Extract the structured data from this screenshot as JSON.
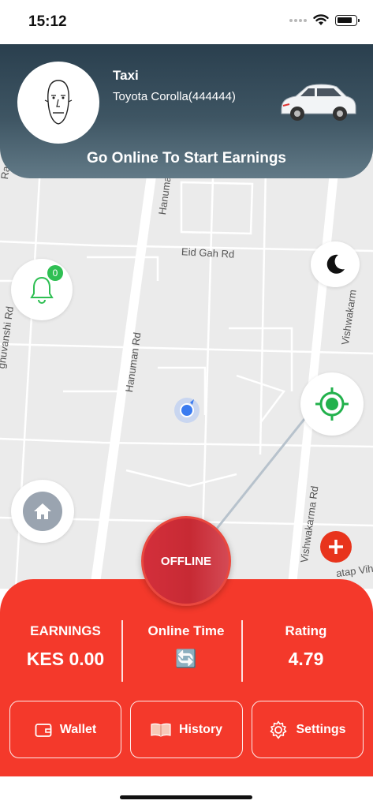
{
  "status_bar": {
    "time": "15:12"
  },
  "header": {
    "driver_type": "Taxi",
    "vehicle": "Toyota Corolla(444444)",
    "online_message": "Go Online To Start Earnings"
  },
  "map": {
    "roads": [
      "Raghuvansh",
      "Hanuman Rd",
      "Eid Gah Rd",
      "Vishwakarm",
      "Hanuman Rd",
      "ghuvanshi Rd",
      "Vishwakarma Rd",
      "atap Vih"
    ]
  },
  "notifications": {
    "count": "0"
  },
  "status_button": {
    "label": "OFFLINE"
  },
  "stats": {
    "earnings_label": "EARNINGS",
    "earnings_value": "KES 0.00",
    "online_time_label": "Online Time",
    "online_time_icon": "🔄",
    "rating_label": "Rating",
    "rating_value": "4.79"
  },
  "actions": {
    "wallet": "Wallet",
    "history": "History",
    "settings": "Settings"
  },
  "colors": {
    "panel": "#f4392b",
    "offline": "#d32f3b",
    "header": "#2a3f4e",
    "accent_green": "#2fbf53"
  }
}
